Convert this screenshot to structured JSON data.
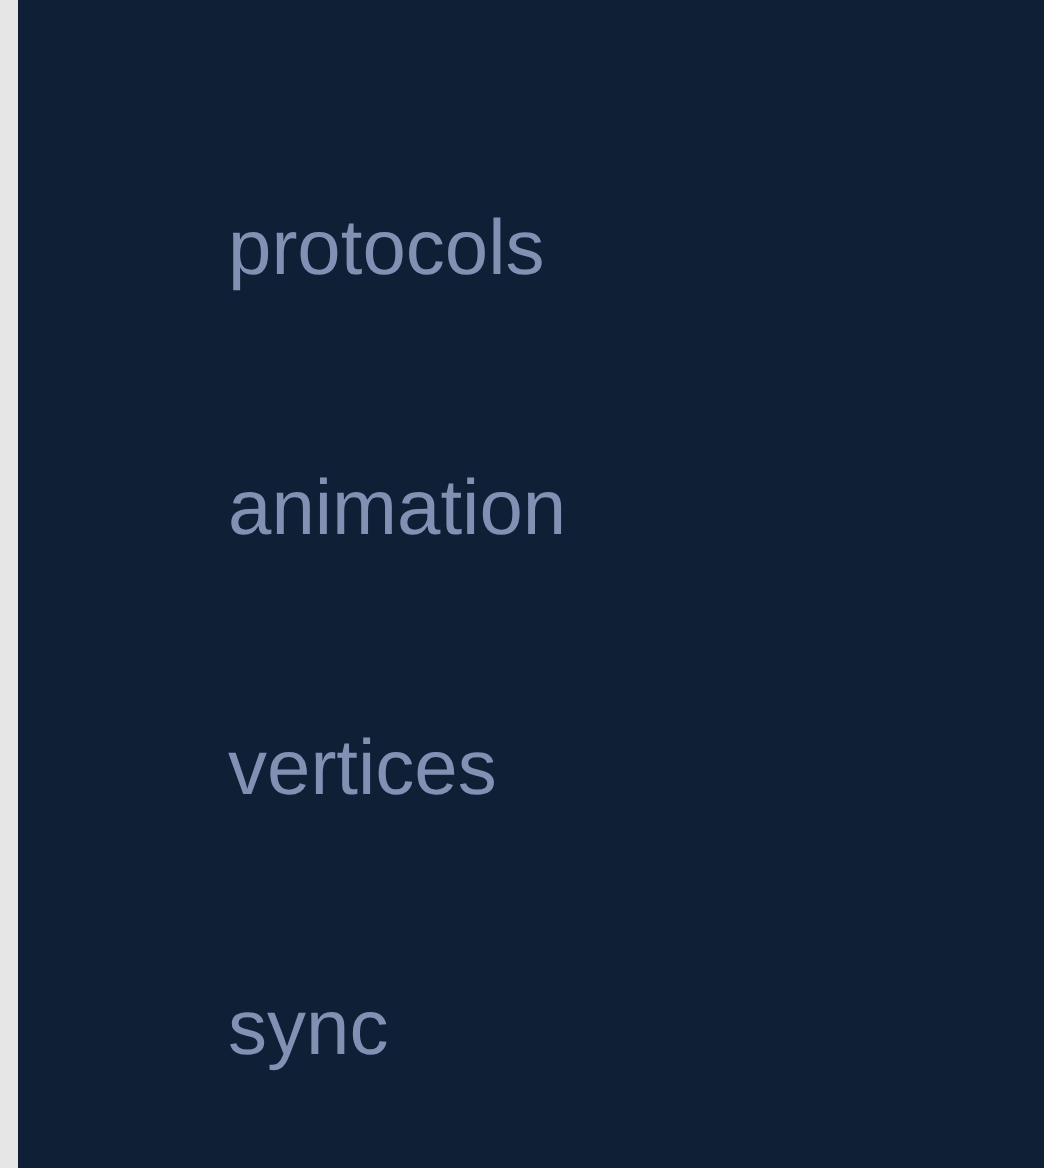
{
  "menu": {
    "items": [
      {
        "label": "protocols"
      },
      {
        "label": "animation"
      },
      {
        "label": "vertices"
      },
      {
        "label": "sync"
      }
    ]
  }
}
